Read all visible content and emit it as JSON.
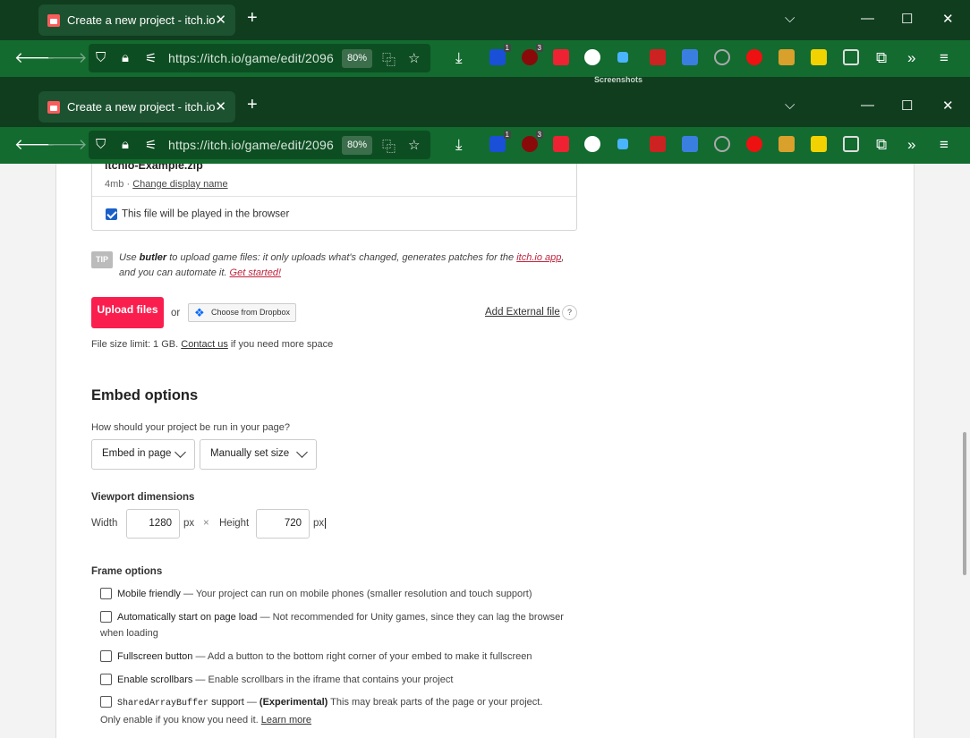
{
  "browser": {
    "tab_title": "Create a new project - itch.io",
    "url": "https://itch.io/game/edit/2096",
    "zoom": "80%",
    "screenshots_label": "Screenshots",
    "badges": {
      "ublock": "1",
      "ext3": "3"
    }
  },
  "upload": {
    "file_name": "itchio-Example.zip",
    "file_size": "4mb",
    "change_display_name": "Change display name",
    "played_in_browser": "This file will be played in the browser",
    "played_checked": true
  },
  "tip": {
    "label": "TIP",
    "pre": "Use ",
    "butler": "butler",
    "mid": " to upload game files: it only uploads what's changed, generates patches for the ",
    "app_link": "itch.io app",
    "post": ", and you can automate it. ",
    "get_started": "Get started!"
  },
  "actions": {
    "upload_files": "Upload files",
    "or": "or",
    "dropbox": "Choose from Dropbox",
    "add_external": "Add External file",
    "help": "?"
  },
  "limit": {
    "pre": "File size limit: 1 GB. ",
    "contact": "Contact us",
    "post": " if you need more space"
  },
  "embed": {
    "heading": "Embed options",
    "question": "How should your project be run in your page?",
    "mode": "Embed in page",
    "size_mode": "Manually set size"
  },
  "viewport": {
    "heading": "Viewport dimensions",
    "width_label": "Width",
    "width": "1280",
    "unit": "px",
    "times": "×",
    "height_label": "Height",
    "height": "720"
  },
  "frame": {
    "heading": "Frame options",
    "mobile_title": "Mobile friendly",
    "mobile_desc": " — Your project can run on mobile phones (smaller resolution and touch support)",
    "autostart_title": "Automatically start on page load",
    "autostart_desc": " — Not recommended for Unity games, since they can lag the browser when loading",
    "fullscreen_title": "Fullscreen button",
    "fullscreen_desc": " — Add a button to the bottom right corner of your embed to make it fullscreen",
    "scroll_title": "Enable scrollbars",
    "scroll_desc": " — Enable scrollbars in the iframe that contains your project",
    "sab_mono": "SharedArrayBuffer",
    "sab_title": " support",
    "sab_dash": " — ",
    "sab_exp": "(Experimental)",
    "sab_desc": " This may break parts of the page or your project. Only enable if you know you need it. ",
    "learn_more": "Learn more"
  }
}
